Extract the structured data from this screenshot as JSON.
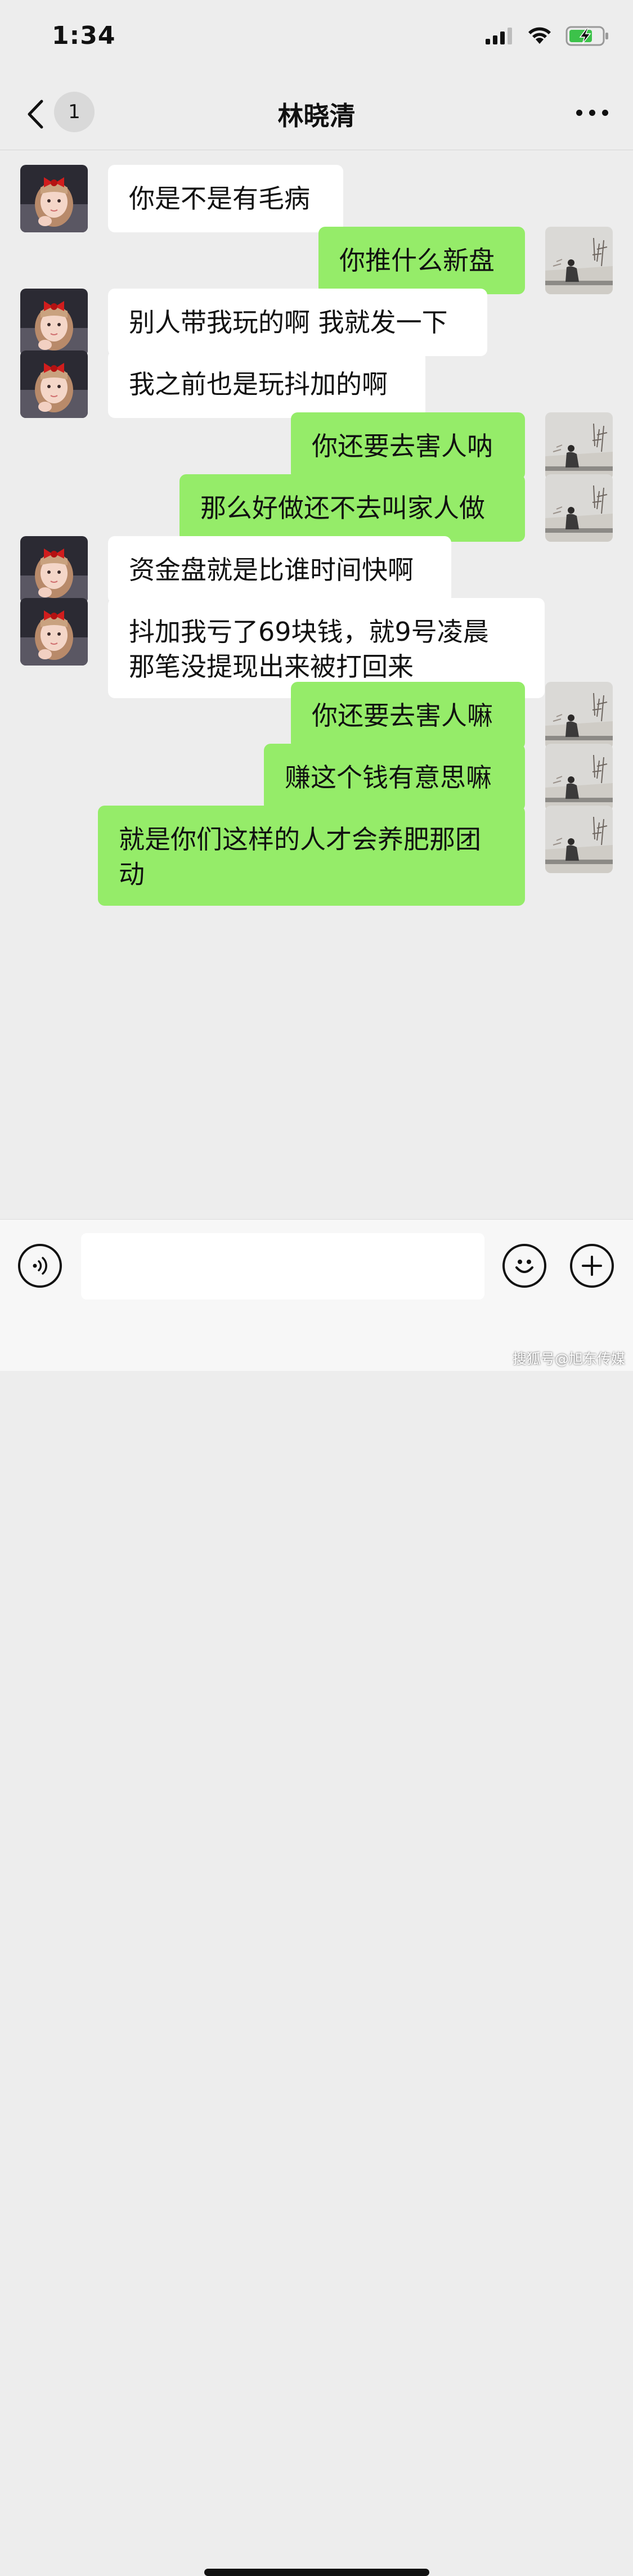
{
  "status_bar": {
    "time": "1:34",
    "icons": [
      "cellular-signal-icon",
      "wifi-icon",
      "battery-charging-icon"
    ]
  },
  "nav": {
    "back_icon": "chevron-left-icon",
    "unread_count": "1",
    "title": "林晓清",
    "more_icon": "ellipsis-icon"
  },
  "colors": {
    "background": "#ededed",
    "incoming_bubble": "#ffffff",
    "outgoing_bubble": "#95ec69"
  },
  "messages": [
    {
      "side": "left",
      "text": "你是不是有毛病"
    },
    {
      "side": "right",
      "text": "你推什么新盘"
    },
    {
      "side": "left",
      "text": "别人带我玩的啊 我就发一下"
    },
    {
      "side": "left",
      "text": "我之前也是玩抖加的啊"
    },
    {
      "side": "right",
      "text": "你还要去害人呐"
    },
    {
      "side": "right",
      "text": "那么好做还不去叫家人做"
    },
    {
      "side": "left",
      "text": "资金盘就是比谁时间快啊"
    },
    {
      "side": "left",
      "text": "抖加我亏了69块钱，就9号凌晨\n那笔没提现出来被打回来"
    },
    {
      "side": "right",
      "text": "你还要去害人嘛"
    },
    {
      "side": "right",
      "text": "赚这个钱有意思嘛"
    },
    {
      "side": "right",
      "text": "就是你们这样的人才会养肥那团\n动"
    }
  ],
  "input_bar": {
    "voice_icon": "voice-icon",
    "input_value": "",
    "emoji_icon": "smiley-icon",
    "plus_icon": "plus-icon"
  },
  "watermark": "搜狐号@旭东传媒"
}
